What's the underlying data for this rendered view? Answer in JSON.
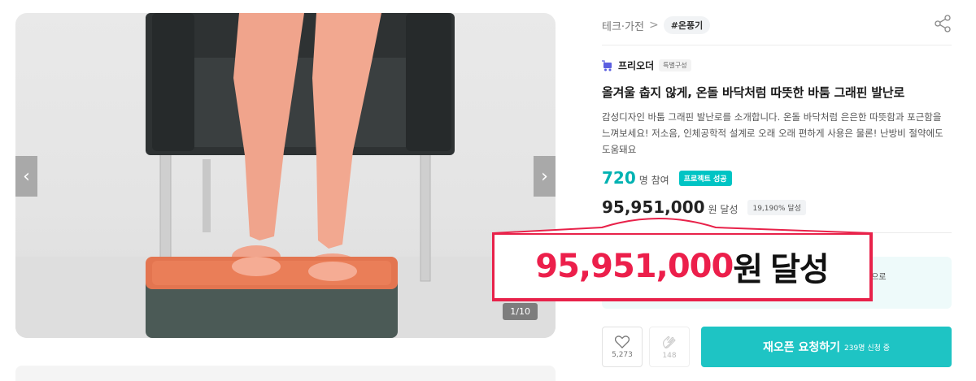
{
  "gallery": {
    "counter": "1/10",
    "prev_icon": "chevron-left-icon",
    "next_icon": "chevron-right-icon",
    "prev_glyph": "‹",
    "next_glyph": "›"
  },
  "breadcrumb": {
    "category": "테크·가전",
    "separator": ">",
    "tag": "#온풍기"
  },
  "maker": {
    "name": "프리오더",
    "badge": "특별구성"
  },
  "project": {
    "title": "올겨울 춥지 않게, 온돌 바닥처럼 따뜻한 바툼 그래핀 발난로",
    "description_lines": [
      "감성디자인 바툼 그래핀 발난로를 소개합니다. 온돌 바닥처럼 은은한 따뜻함과 포근함을",
      "느껴보세요! 저소음, 인체공학적 설계로 오래 오래 편하게 사용은 물론! 난방비 절약에도",
      "도움돼요"
    ]
  },
  "stats": {
    "participants": "720",
    "participants_unit": "명 참여",
    "success_badge": "프로젝트 성공",
    "amount": "95,951,000",
    "amount_unit": "원 달성",
    "percent_badge": "19,190% 달성"
  },
  "notice": {
    "text_fragment": "적으로"
  },
  "actions": {
    "like_count": "5,273",
    "cheer_count": "148",
    "reopen_label": "재오픈 요청하기",
    "reopen_sub": "239명 신청 중"
  },
  "callout": {
    "amount": "95,951,000",
    "won": "원",
    "achieved": "달성"
  },
  "colors": {
    "accent_teal": "#1ec4c4",
    "callout_red": "#ec1f4b"
  }
}
